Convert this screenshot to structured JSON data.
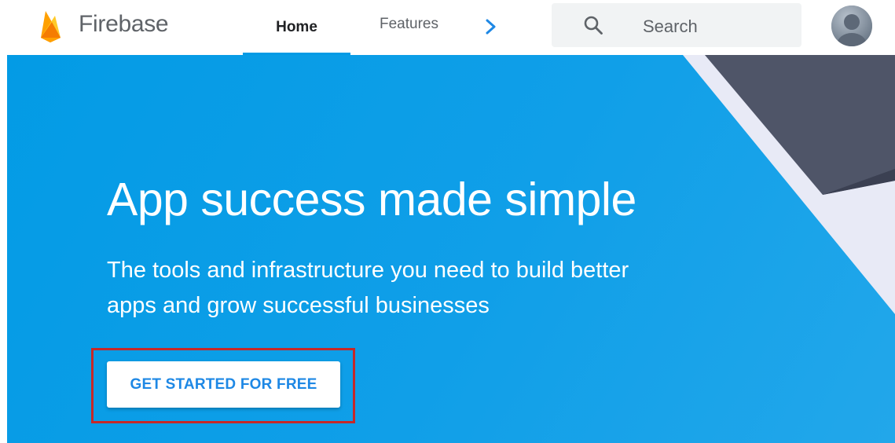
{
  "header": {
    "brand": "Firebase",
    "nav": {
      "home_label": "Home",
      "features_label": "Features"
    },
    "search": {
      "placeholder": "Search"
    },
    "icons": {
      "logo": "firebase-flame-icon",
      "more": "chevron-right-icon",
      "search": "search-icon",
      "avatar": "user-avatar"
    }
  },
  "hero": {
    "headline": "App success made simple",
    "subheadline": "The tools and infrastructure you need to build better apps and grow successful businesses",
    "cta_label": "GET STARTED FOR FREE"
  },
  "colors": {
    "accent": "#039be5",
    "cta_text": "#1e88e5",
    "highlight_box": "#c62828"
  }
}
